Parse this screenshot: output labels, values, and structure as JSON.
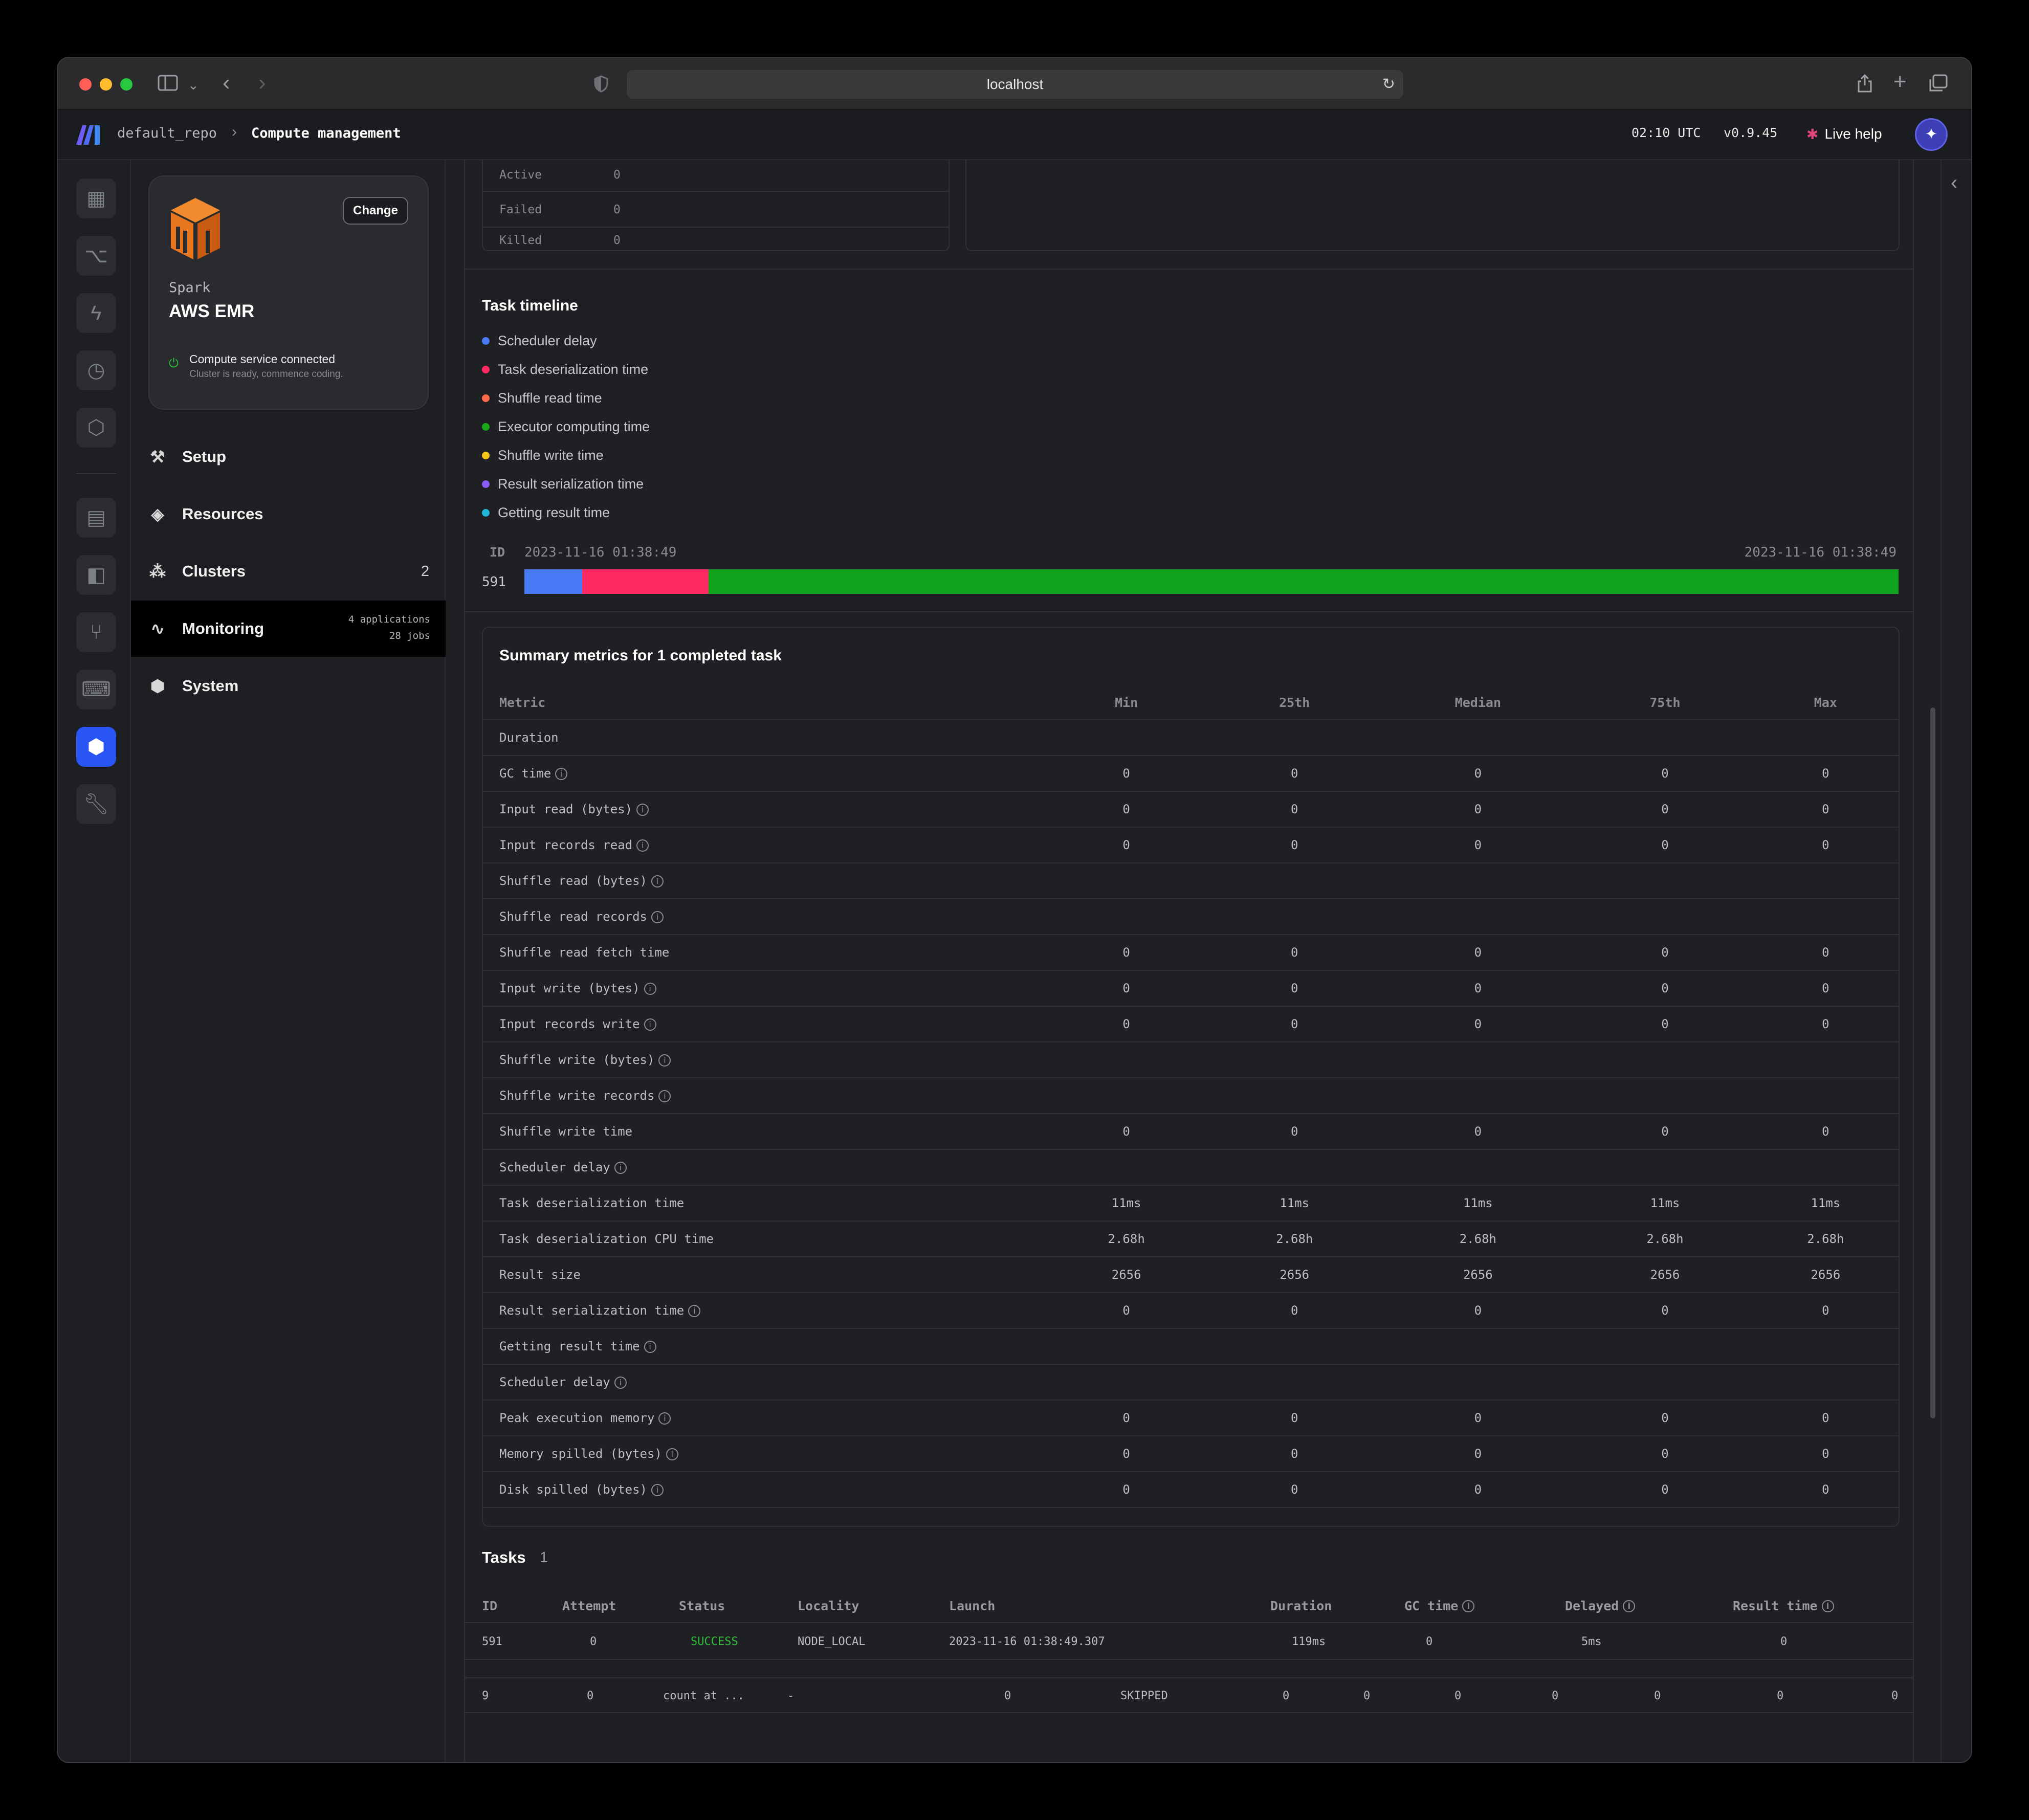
{
  "browser": {
    "address": "localhost"
  },
  "topbar": {
    "repo": "default_repo",
    "page": "Compute management",
    "time": "02:10 UTC",
    "version": "v0.9.45",
    "help": "Live help"
  },
  "service": {
    "change": "Change",
    "type": "Spark",
    "name": "AWS EMR",
    "status": "Compute service connected",
    "status_sub": "Cluster is ready, commence coding.",
    "brand_color": "#e8761f"
  },
  "nav": {
    "setup": "Setup",
    "resources": "Resources",
    "clusters": "Clusters",
    "clusters_count": "2",
    "monitoring": "Monitoring",
    "monitoring_apps": "4 applications",
    "monitoring_jobs": "28 jobs",
    "system": "System"
  },
  "stage_counts": [
    {
      "label": "Active",
      "value": "0"
    },
    {
      "label": "Failed",
      "value": "0"
    },
    {
      "label": "Killed",
      "value": "0"
    }
  ],
  "timeline": {
    "title": "Task timeline",
    "legend": [
      {
        "label": "Scheduler delay",
        "color": "#4a7bf7"
      },
      {
        "label": "Task deserialization time",
        "color": "#ff2a63"
      },
      {
        "label": "Shuffle read time",
        "color": "#ff6b4a"
      },
      {
        "label": "Executor computing time",
        "color": "#1aa818"
      },
      {
        "label": "Shuffle write time",
        "color": "#f5c518"
      },
      {
        "label": "Result serialization time",
        "color": "#8a5cf6"
      },
      {
        "label": "Getting result time",
        "color": "#1fb8d8"
      }
    ],
    "id_label": "ID",
    "start": "2023-11-16 01:38:49",
    "end": "2023-11-16 01:38:49",
    "task_id": "591",
    "segments": [
      {
        "fraction": 0.042,
        "color": "#4a7bf7"
      },
      {
        "fraction": 0.092,
        "color": "#ff2a63"
      },
      {
        "fraction": 0.866,
        "color": "#0fa31e"
      }
    ]
  },
  "summary": {
    "title": "Summary metrics for 1 completed task",
    "columns": [
      "Metric",
      "Min",
      "25th",
      "Median",
      "75th",
      "Max"
    ],
    "rows": [
      {
        "metric": "Duration",
        "info": false,
        "values": [
          "",
          "",
          "",
          "",
          ""
        ]
      },
      {
        "metric": "GC time",
        "info": true,
        "values": [
          "0",
          "0",
          "0",
          "0",
          "0"
        ]
      },
      {
        "metric": "Input read (bytes)",
        "info": true,
        "values": [
          "0",
          "0",
          "0",
          "0",
          "0"
        ]
      },
      {
        "metric": "Input records read",
        "info": true,
        "values": [
          "0",
          "0",
          "0",
          "0",
          "0"
        ]
      },
      {
        "metric": "Shuffle read (bytes)",
        "info": true,
        "values": [
          "",
          "",
          "",
          "",
          ""
        ]
      },
      {
        "metric": "Shuffle read records",
        "info": true,
        "values": [
          "",
          "",
          "",
          "",
          ""
        ]
      },
      {
        "metric": "Shuffle read fetch time",
        "info": false,
        "values": [
          "0",
          "0",
          "0",
          "0",
          "0"
        ]
      },
      {
        "metric": "Input write (bytes)",
        "info": true,
        "values": [
          "0",
          "0",
          "0",
          "0",
          "0"
        ]
      },
      {
        "metric": "Input records write",
        "info": true,
        "values": [
          "0",
          "0",
          "0",
          "0",
          "0"
        ]
      },
      {
        "metric": "Shuffle write (bytes)",
        "info": true,
        "values": [
          "",
          "",
          "",
          "",
          ""
        ]
      },
      {
        "metric": "Shuffle write records",
        "info": true,
        "values": [
          "",
          "",
          "",
          "",
          ""
        ]
      },
      {
        "metric": "Shuffle write time",
        "info": false,
        "values": [
          "0",
          "0",
          "0",
          "0",
          "0"
        ]
      },
      {
        "metric": "Scheduler delay",
        "info": true,
        "values": [
          "",
          "",
          "",
          "",
          ""
        ]
      },
      {
        "metric": "Task deserialization time",
        "info": false,
        "values": [
          "11ms",
          "11ms",
          "11ms",
          "11ms",
          "11ms"
        ]
      },
      {
        "metric": "Task deserialization CPU time",
        "info": false,
        "values": [
          "2.68h",
          "2.68h",
          "2.68h",
          "2.68h",
          "2.68h"
        ]
      },
      {
        "metric": "Result size",
        "info": false,
        "values": [
          "2656",
          "2656",
          "2656",
          "2656",
          "2656"
        ]
      },
      {
        "metric": "Result serialization time",
        "info": true,
        "values": [
          "0",
          "0",
          "0",
          "0",
          "0"
        ]
      },
      {
        "metric": "Getting result time",
        "info": true,
        "values": [
          "",
          "",
          "",
          "",
          ""
        ]
      },
      {
        "metric": "Scheduler delay",
        "info": true,
        "values": [
          "",
          "",
          "",
          "",
          ""
        ]
      },
      {
        "metric": "Peak execution memory",
        "info": true,
        "values": [
          "0",
          "0",
          "0",
          "0",
          "0"
        ]
      },
      {
        "metric": "Memory spilled (bytes)",
        "info": true,
        "values": [
          "0",
          "0",
          "0",
          "0",
          "0"
        ]
      },
      {
        "metric": "Disk spilled (bytes)",
        "info": true,
        "values": [
          "0",
          "0",
          "0",
          "0",
          "0"
        ]
      }
    ]
  },
  "tasks": {
    "title": "Tasks",
    "count": "1",
    "columns": [
      "ID",
      "Attempt",
      "Status",
      "Locality",
      "Launch",
      "Duration",
      "GC time",
      "Delayed",
      "Result time"
    ],
    "row": {
      "id": "591",
      "attempt": "0",
      "status": "SUCCESS",
      "locality": "NODE_LOCAL",
      "launch": "2023-11-16 01:38:49.307",
      "duration": "119ms",
      "gc": "0",
      "delayed": "5ms",
      "result": "0"
    },
    "status_color": "#2fbf3a"
  },
  "stage_row": [
    "9",
    "0",
    "count at ...",
    "-",
    "0",
    "SKIPPED",
    "0",
    "0",
    "0",
    "0",
    "0",
    "0",
    "0"
  ]
}
